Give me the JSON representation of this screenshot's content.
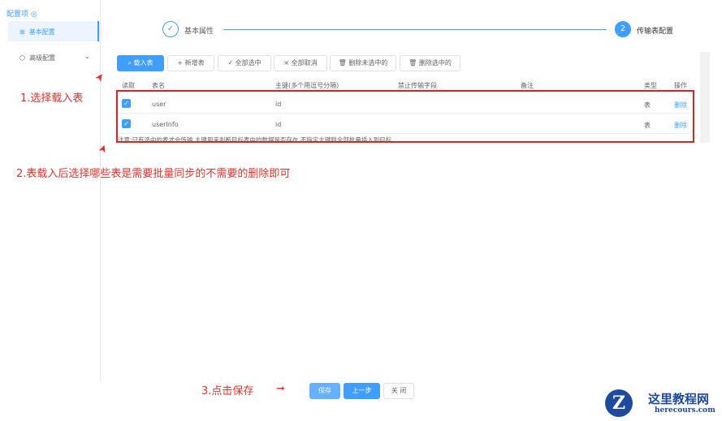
{
  "sidebar": {
    "title": "配置项",
    "items": [
      {
        "label": "基本配置"
      },
      {
        "label": "高级配置"
      }
    ]
  },
  "steps": [
    {
      "num": "✓",
      "label": "基本属性"
    },
    {
      "num": "2",
      "label": "传输表配置"
    }
  ],
  "toolbar": [
    "载入表",
    "新增表",
    "全部选中",
    "全部取消",
    "删除未选中的",
    "删除选中的"
  ],
  "table": {
    "headers": [
      "读取",
      "表名",
      "主键(多个用逗号分隔)",
      "禁止传输字段",
      "备注",
      "类型",
      "操作"
    ],
    "rows": [
      {
        "name": "user",
        "key": "id",
        "type": "表",
        "action": "删除"
      },
      {
        "name": "userInfo",
        "key": "id",
        "type": "表",
        "action": "删除"
      }
    ],
    "note": "注意:只有选中的表才会传输 主键用来判断目标表中的数据是否存在 不指定主键则全部批量插入到目标"
  },
  "annotations": [
    "1.选择载入表",
    "2.表载入后选择哪些表是需要批量同步的不需要的删除即可",
    "3.点击保存"
  ],
  "footer": {
    "save": "保存",
    "prev": "上一步",
    "close": "关 闭"
  },
  "watermark": {
    "title": "这里教程网",
    "url": "herecours.com"
  }
}
